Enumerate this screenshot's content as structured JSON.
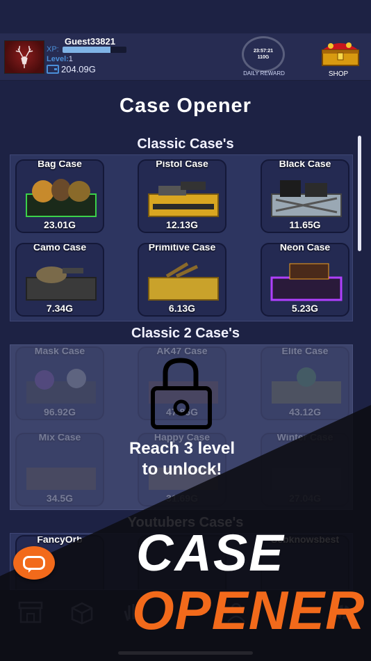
{
  "player": {
    "username": "Guest33821",
    "xp_label": "XP:",
    "xp_fraction": 0.75,
    "level_label": "Level:",
    "level_value": "1",
    "gold": "204.09G"
  },
  "daily_reward": {
    "timer": "23:57:21",
    "amount": "110G",
    "label": "DAILY REWARD"
  },
  "shop": {
    "label": "SHOP"
  },
  "page_title": "Case Opener",
  "sections": [
    {
      "title": "Classic Case's",
      "cases": [
        {
          "name": "Bag Case",
          "price": "23.01G"
        },
        {
          "name": "Pistol Case",
          "price": "12.13G"
        },
        {
          "name": "Black Case",
          "price": "11.65G"
        },
        {
          "name": "Camo Case",
          "price": "7.34G"
        },
        {
          "name": "Primitive Case",
          "price": "6.13G"
        },
        {
          "name": "Neon Case",
          "price": "5.23G"
        }
      ]
    },
    {
      "title": "Classic 2 Case's",
      "locked": true,
      "lock_message_1": "Reach 3 level",
      "lock_message_2": "to unlock!",
      "cases": [
        {
          "name": "Mask Case",
          "price": "96.92G"
        },
        {
          "name": "AK47 Case",
          "price": "47.86G"
        },
        {
          "name": "Elite Case",
          "price": "43.12G"
        },
        {
          "name": "Mix Case",
          "price": "34.5G"
        },
        {
          "name": "Happy Case",
          "price": "31.69G"
        },
        {
          "name": "Winter Case",
          "price": "27.04G"
        }
      ]
    },
    {
      "title": "Youtubers Case's",
      "cases": [
        {
          "name": "FancyOrb",
          "price": ""
        },
        {
          "name": "",
          "price": ""
        },
        {
          "name": "Sebknowsbest",
          "price": ""
        }
      ]
    }
  ],
  "banner": {
    "line1": "CASE",
    "line2": "OPENER"
  },
  "colors": {
    "accent": "#f26a1b",
    "background": "#1d2244",
    "panel": "#2d3560"
  },
  "nav_icons": [
    "store-icon",
    "box-icon",
    "hand-icon",
    "chat-bubble-icon",
    "gear-icon"
  ]
}
